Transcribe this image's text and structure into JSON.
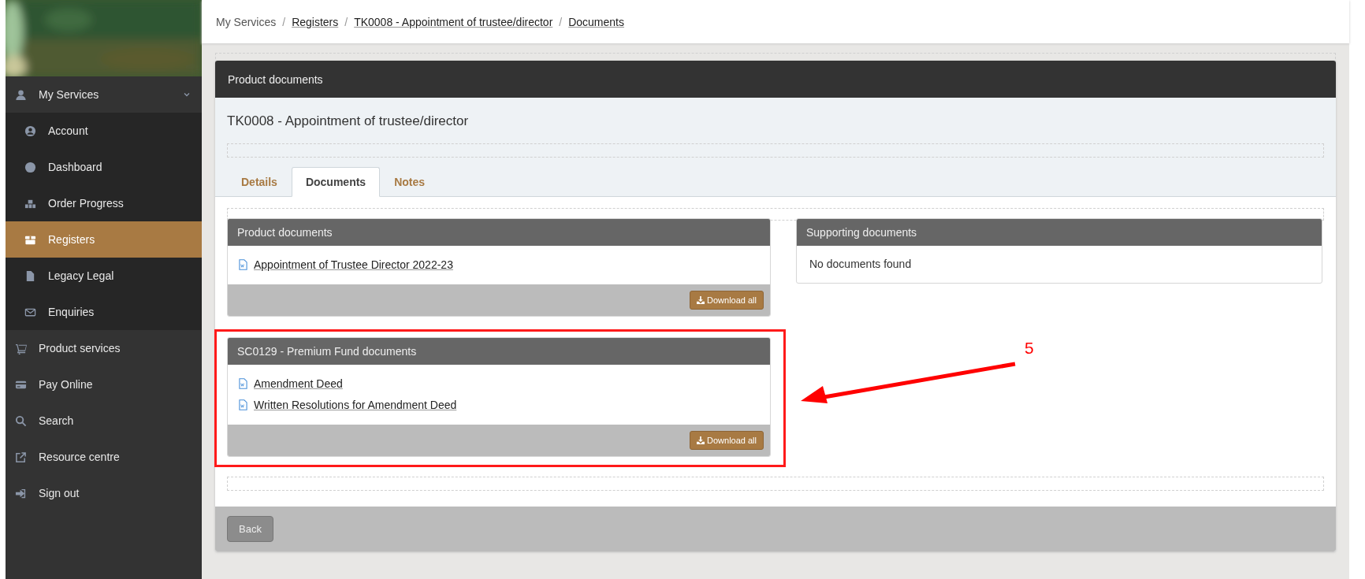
{
  "breadcrumb": [
    {
      "label": "My Services",
      "link": false
    },
    {
      "separator": "/",
      "label": "Registers",
      "link": true
    },
    {
      "separator": "/",
      "label": "TK0008 - Appointment of trustee/director",
      "link": true
    },
    {
      "separator": "/",
      "label": "Documents",
      "link": true
    }
  ],
  "sidebar": {
    "items": [
      {
        "label": "My Services",
        "selected": false,
        "expanded": true,
        "children": [
          {
            "label": "Account",
            "selected": false
          },
          {
            "label": "Dashboard",
            "selected": false
          },
          {
            "label": "Order Progress",
            "selected": false
          },
          {
            "label": "Registers",
            "selected": true
          },
          {
            "label": "Legacy Legal",
            "selected": false
          },
          {
            "label": "Enquiries",
            "selected": false
          }
        ]
      },
      {
        "label": "Product services",
        "selected": false
      },
      {
        "label": "Pay Online",
        "selected": false
      },
      {
        "label": "Search",
        "selected": false
      },
      {
        "label": "Resource centre",
        "selected": false
      },
      {
        "label": "Sign out",
        "selected": false
      }
    ]
  },
  "card": {
    "header": "Product documents",
    "title": "TK0008 - Appointment of trustee/director",
    "tabs": [
      {
        "label": "Details",
        "selected": false
      },
      {
        "label": "Documents",
        "selected": true
      },
      {
        "label": "Notes",
        "selected": false
      }
    ],
    "panels": [
      {
        "title": "Product documents",
        "documents": [
          "Appointment of Trustee Director 2022-23"
        ],
        "button": "Download all",
        "highlighted": false
      },
      {
        "title": "Supporting documents",
        "empty_text": "No documents found",
        "highlighted": false
      },
      {
        "title": "SC0129 - Premium Fund documents",
        "documents": [
          "Amendment Deed",
          "Written Resolutions for Amendment Deed"
        ],
        "button": "Download all",
        "highlighted": true
      }
    ],
    "back_button": "Back"
  },
  "annotation": {
    "label": "5"
  }
}
